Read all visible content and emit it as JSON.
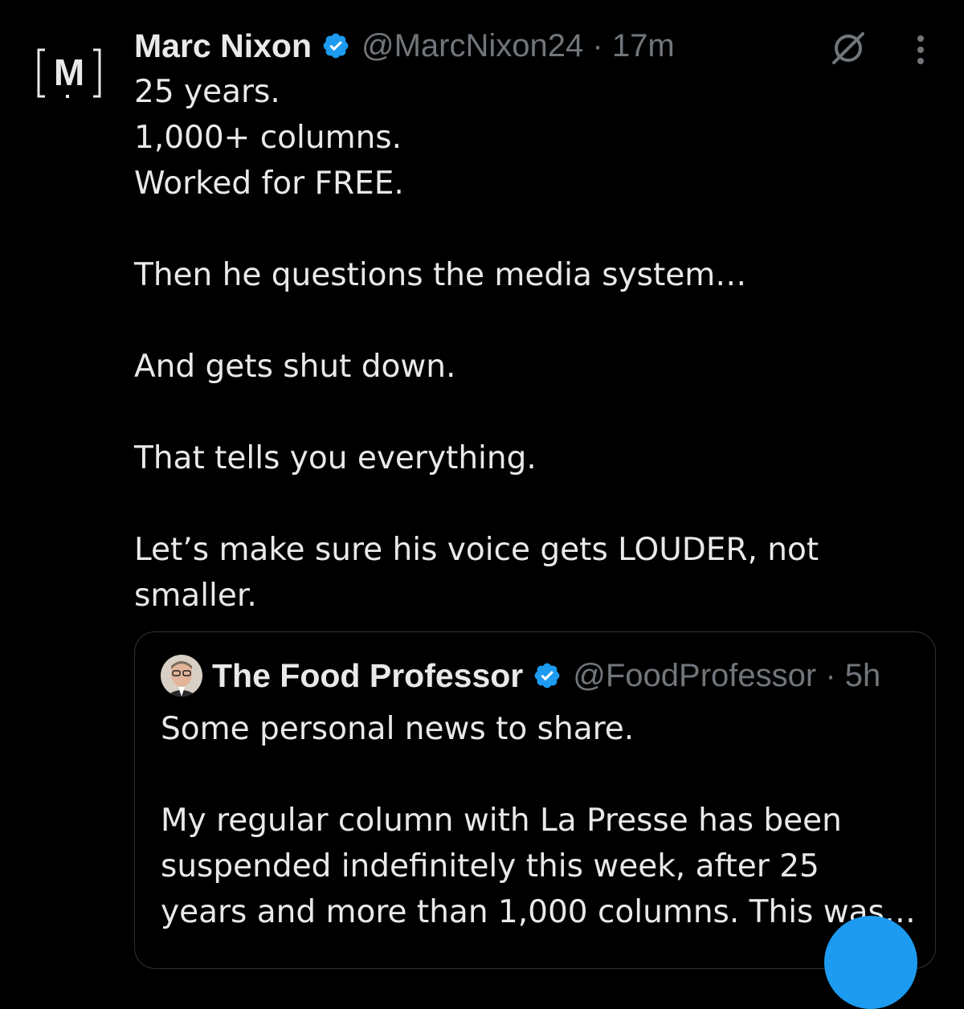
{
  "tweet": {
    "author_name": "Marc Nixon",
    "handle": "@MarcNixon24",
    "separator": "·",
    "time": "17m",
    "avatar_letter": "M",
    "lines": [
      "25 years.",
      "1,000+ columns.",
      "Worked for FREE.",
      "",
      "Then he questions the media system…",
      "",
      "And gets shut down.",
      "",
      "That tells you everything.",
      "",
      "Let’s make sure his voice gets LOUDER, not",
      "smaller."
    ]
  },
  "quoted_tweet": {
    "author_name": "The Food Professor",
    "handle": "@FoodProfessor",
    "separator": "·",
    "time": "5h",
    "lines": [
      "Some personal news to share.",
      "",
      "My regular column with La Presse has been",
      "suspended indefinitely this week, after 25",
      "years and more than 1,000 columns. This was…"
    ]
  },
  "icons": {
    "verified": "verified-badge-icon",
    "grok": "grok-icon",
    "more": "more-vertical-icon"
  },
  "colors": {
    "background": "#000000",
    "text": "#e7e9ea",
    "secondary": "#71767b",
    "accent": "#1d9bf0",
    "border": "#2f3336"
  }
}
